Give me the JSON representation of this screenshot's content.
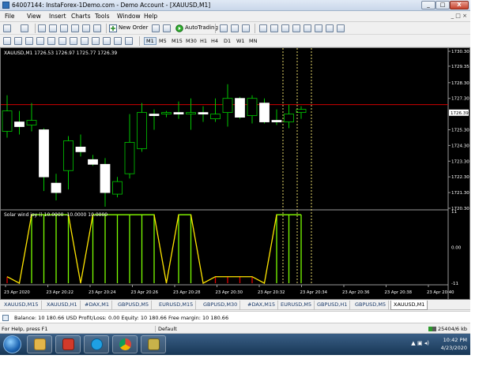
{
  "window": {
    "title": "64007144: InstaForex-1Demo.com - Demo Account - [XAUUSD,M1]",
    "min_label": "_",
    "max_label": "□",
    "close_label": "X"
  },
  "menu": {
    "items": [
      "File",
      "View",
      "Insert",
      "Charts",
      "Tools",
      "Window",
      "Help"
    ],
    "mdi_controls": "_ □ ×"
  },
  "toolbar": {
    "new_order_label": "New Order",
    "autotrading_label": "AutoTrading",
    "timeframes": [
      "M1",
      "M5",
      "M15",
      "M30",
      "H1",
      "H4",
      "D1",
      "W1",
      "MN"
    ],
    "active_timeframe": "M1"
  },
  "chart": {
    "symbol_info": "XAUUSD,M1  1726.53 1726.97 1725.77 1726.39",
    "indicator_label": "Solar wind joy ()  10.0000 -10.0000 10.0000",
    "price_labels": [
      "1730.30",
      "1729.35",
      "1728.30",
      "1727.30",
      "1726.39",
      "1725.30",
      "1724.30",
      "1723.30",
      "1722.30",
      "1721.30",
      "1720.30"
    ],
    "current_price": "1726.39",
    "indicator_scale": [
      "11",
      "0.00",
      "-11"
    ],
    "time_labels": [
      "23 Apr 2020",
      "23 Apr 20:22",
      "23 Apr 20:24",
      "23 Apr 20:26",
      "23 Apr 20:28",
      "23 Apr 20:30",
      "23 Apr 20:32",
      "23 Apr 20:34",
      "23 Apr 20:36",
      "23 Apr 20:38",
      "23 Apr 20:40"
    ],
    "colors": {
      "background": "#000000",
      "bull_candle": "#ffffff",
      "bear_candle": "#000000",
      "wick": "#00c800",
      "ask_line": "#d00000",
      "vline": "#e6d86a",
      "ind_green": "#7cff00",
      "ind_yellow": "#ffe600",
      "ind_red": "#e00000"
    }
  },
  "chart_data": {
    "type": "candlestick",
    "title": "XAUUSD,M1",
    "ylim": [
      1720.3,
      1730.3
    ],
    "candles": [
      {
        "o": 1725.2,
        "h": 1727.5,
        "l": 1724.8,
        "c": 1726.5
      },
      {
        "o": 1725.8,
        "h": 1726.5,
        "l": 1725.0,
        "c": 1725.5
      },
      {
        "o": 1725.6,
        "h": 1727.0,
        "l": 1725.2,
        "c": 1725.9
      },
      {
        "o": 1725.3,
        "h": 1725.4,
        "l": 1721.4,
        "c": 1722.3
      },
      {
        "o": 1721.9,
        "h": 1722.5,
        "l": 1720.8,
        "c": 1721.3
      },
      {
        "o": 1722.7,
        "h": 1724.9,
        "l": 1721.5,
        "c": 1724.6
      },
      {
        "o": 1724.2,
        "h": 1725.0,
        "l": 1723.6,
        "c": 1723.9
      },
      {
        "o": 1723.4,
        "h": 1723.7,
        "l": 1723.0,
        "c": 1723.1
      },
      {
        "o": 1723.1,
        "h": 1723.5,
        "l": 1720.4,
        "c": 1721.3
      },
      {
        "o": 1721.2,
        "h": 1722.3,
        "l": 1721.0,
        "c": 1722.0
      },
      {
        "o": 1722.5,
        "h": 1726.3,
        "l": 1722.2,
        "c": 1724.5
      },
      {
        "o": 1724.1,
        "h": 1727.0,
        "l": 1723.9,
        "c": 1726.4
      },
      {
        "o": 1726.3,
        "h": 1726.6,
        "l": 1725.3,
        "c": 1726.2
      },
      {
        "o": 1726.3,
        "h": 1726.5,
        "l": 1726.1,
        "c": 1726.4
      },
      {
        "o": 1726.4,
        "h": 1727.1,
        "l": 1726.0,
        "c": 1726.3
      },
      {
        "o": 1726.3,
        "h": 1727.3,
        "l": 1725.3,
        "c": 1726.4
      },
      {
        "o": 1726.4,
        "h": 1726.8,
        "l": 1725.8,
        "c": 1726.3
      },
      {
        "o": 1726.0,
        "h": 1727.3,
        "l": 1725.8,
        "c": 1726.3
      },
      {
        "o": 1726.4,
        "h": 1728.2,
        "l": 1725.5,
        "c": 1727.3
      },
      {
        "o": 1727.3,
        "h": 1727.4,
        "l": 1726.0,
        "c": 1726.1
      },
      {
        "o": 1726.2,
        "h": 1727.5,
        "l": 1725.7,
        "c": 1727.3
      },
      {
        "o": 1727.0,
        "h": 1727.3,
        "l": 1725.7,
        "c": 1725.8
      },
      {
        "o": 1725.9,
        "h": 1726.6,
        "l": 1725.6,
        "c": 1725.8
      },
      {
        "o": 1725.8,
        "h": 1726.9,
        "l": 1725.4,
        "c": 1726.3
      },
      {
        "o": 1726.4,
        "h": 1726.8,
        "l": 1726.0,
        "c": 1726.6
      }
    ],
    "indicator": {
      "name": "Solar wind joy",
      "values": [
        -9,
        -11,
        10,
        10,
        10,
        10,
        -11,
        10,
        10,
        10,
        10,
        10,
        10,
        -11,
        10,
        10,
        -11,
        -9,
        -9,
        -9,
        -9,
        -11,
        10,
        10,
        10
      ]
    }
  },
  "tabs": {
    "items": [
      "XAUUSD,M15",
      "XAUUSD,H1",
      "#DAX,M1",
      "GBPUSD,M5",
      "EURUSD,M15",
      "GBPUSD,M30",
      "#DAX,M15",
      "EURUSD,M5",
      "GBPUSD,H1",
      "GBPUSD,M5",
      "XAUUSD,M1"
    ],
    "active": "XAUUSD,M1"
  },
  "terminal": {
    "balance_text": "Balance: 10 180.66 USD  Profit/Loss: 0.00  Equity: 10 180.66  Free margin: 10 180.66"
  },
  "status": {
    "help": "For Help, press F1",
    "profile": "Default",
    "traffic": "25404/6 kb"
  },
  "taskbar": {
    "time": "10:42 PM",
    "date": "4/23/2020",
    "tray_icons": "▲ ▣ ◂)"
  }
}
